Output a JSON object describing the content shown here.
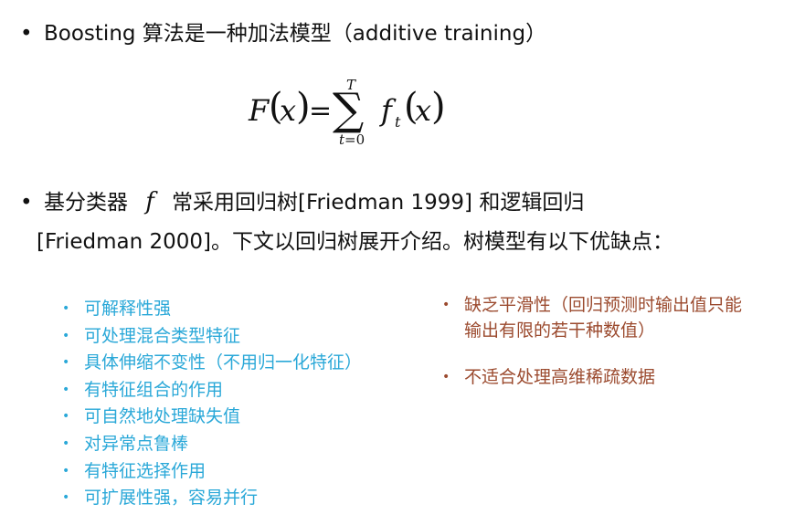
{
  "bullet_mark": "•",
  "line1": {
    "text": "Boosting 算法是一种加法模型（additive training）"
  },
  "formula": {
    "F": "F",
    "x": "x",
    "eq": "=",
    "sigma": "∑",
    "upper": "T",
    "lower_var": "t",
    "lower_rest": "=0",
    "f": "f",
    "f_sub": "t"
  },
  "line2": {
    "before": "基分类器",
    "symbol": "f",
    "after": "常采用回归树[Friedman 1999] 和逻辑回归",
    "continuation": "[Friedman 2000]。下文以回归树展开介绍。树模型有以下优缺点："
  },
  "pros": [
    "可解释性强",
    "可处理混合类型特征",
    "具体伸缩不变性（不用归一化特征）",
    "有特征组合的作用",
    "可自然地处理缺失值",
    "对异常点鲁棒",
    "有特征选择作用",
    "可扩展性强，容易并行"
  ],
  "cons": [
    {
      "line1": "缺乏平滑性（回归预测时输出值只能",
      "line2": "输出有限的若干种数值）"
    },
    {
      "line1": "不适合处理高维稀疏数据"
    }
  ],
  "colors": {
    "pros": "#2aa8d8",
    "cons": "#9b4a2e",
    "text": "#111111"
  }
}
